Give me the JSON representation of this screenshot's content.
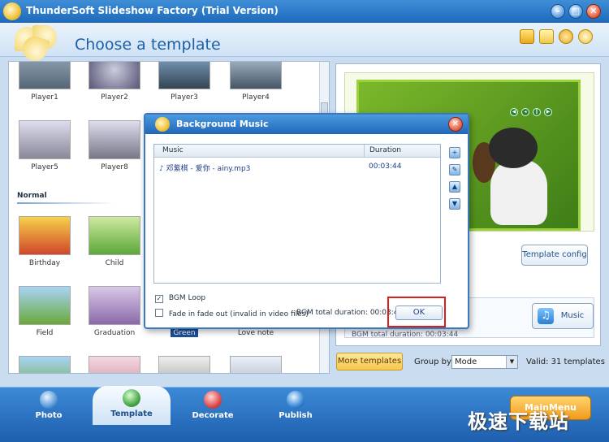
{
  "window": {
    "title": "ThunderSoft Slideshow Factory (Trial Version)",
    "controls": [
      "minimize",
      "maximize",
      "close"
    ]
  },
  "header": {
    "page_title": "Choose a template",
    "icons": [
      "folder-icon",
      "note-icon",
      "help-icon",
      "clover-icon"
    ]
  },
  "template_list": {
    "row1": [
      {
        "label": "Player1"
      },
      {
        "label": "Player2"
      },
      {
        "label": "Player3"
      },
      {
        "label": "Player4"
      }
    ],
    "row2": [
      {
        "label": "Player5"
      },
      {
        "label": "Player8"
      }
    ],
    "section": "Normal",
    "row3": [
      {
        "label": "Birthday"
      },
      {
        "label": "Child"
      }
    ],
    "row4": [
      {
        "label": "Field"
      },
      {
        "label": "Graduation"
      },
      {
        "label": "Green"
      },
      {
        "label": "Love note"
      }
    ]
  },
  "preview": {
    "template_config_label": "Template config",
    "music_label": "Music",
    "bgm_hidden_text": "BGM total duration: 00:03:44"
  },
  "toolbar": {
    "more_templates": "More templates",
    "group_by_label": "Group by",
    "group_by_value": "Mode",
    "valid_text": "Valid: 31 templates"
  },
  "bottom_nav": {
    "tabs": [
      {
        "label": "Photo"
      },
      {
        "label": "Template"
      },
      {
        "label": "Decorate"
      },
      {
        "label": "Publish"
      }
    ],
    "main_menu": "MainMenu",
    "watermark": "极速下载站"
  },
  "dialog": {
    "title": "Background Music",
    "columns": {
      "music": "Music",
      "duration": "Duration"
    },
    "rows": [
      {
        "name": "邓紫棋 - 爱你 - ainy.mp3",
        "duration": "00:03:44"
      }
    ],
    "side_buttons": [
      "add-music-icon",
      "edit-music-icon",
      "move-up-icon",
      "move-down-icon"
    ],
    "bgm_loop_label": "BGM Loop",
    "bgm_loop_checked": true,
    "fade_label": "Fade in fade out (invalid in video files)",
    "fade_checked": false,
    "bgm_total": "BGM total duration: 00:03:44",
    "ok_label": "OK"
  }
}
